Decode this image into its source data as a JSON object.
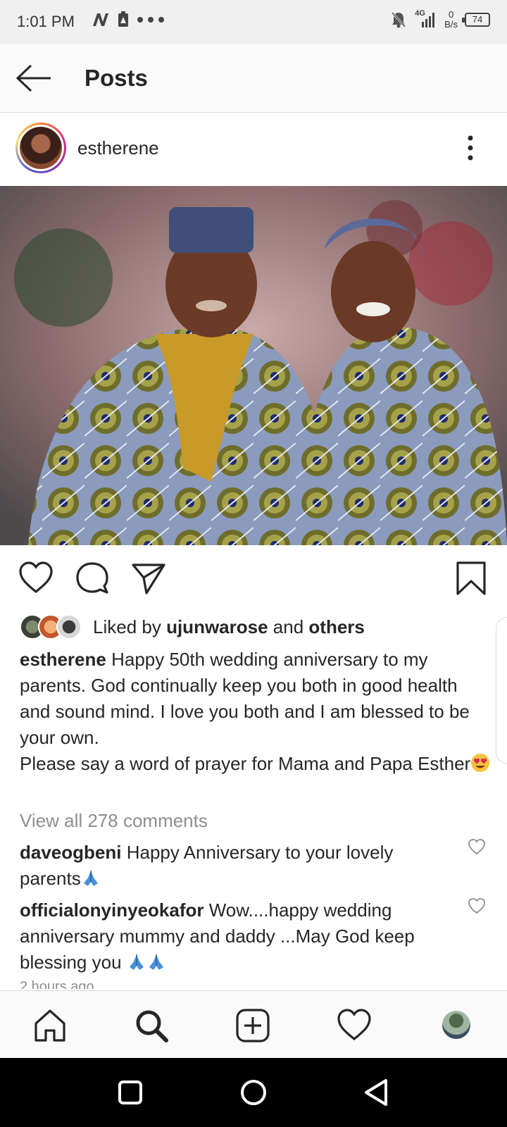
{
  "status_bar": {
    "time": "1:01 PM",
    "network_label": "4G",
    "net_speed_value": "0",
    "net_speed_unit": "B/s",
    "battery": "74",
    "icons": [
      "n-icon",
      "lock-notification-icon",
      "more-dots-icon",
      "mute-icon",
      "signal-icon"
    ]
  },
  "header": {
    "title": "Posts",
    "back_icon": "arrow-left-icon"
  },
  "post": {
    "username": "estherene",
    "more_icon": "vertical-dots-icon",
    "image_description_icon": "photo",
    "likes": {
      "prefix": "Liked by",
      "user": "ujunwarose",
      "middle": "and",
      "suffix": "others"
    },
    "caption": {
      "username": "estherene",
      "text_line1": "Happy 50th wedding anniversary to my parents. God continually keep you both in good health and sound mind. I love you both and I am blessed to be your own.",
      "text_line2": "Please say a word of prayer for Mama and Papa Esther"
    },
    "view_comments": "View all 278 comments",
    "comments": [
      {
        "username": "daveogbeni",
        "text": "Happy Anniversary to your lovely parents"
      },
      {
        "username": "officialonyinyeokafor",
        "text": "Wow....happy wedding anniversary mummy and daddy ...May God keep blessing you"
      }
    ],
    "timestamp": "2 hours ago"
  },
  "bottom_nav": [
    "home-icon",
    "search-icon",
    "add-post-icon",
    "activity-heart-icon",
    "profile-avatar"
  ],
  "android_nav": [
    "recents-square-icon",
    "home-circle-icon",
    "back-triangle-icon"
  ],
  "colors": {
    "text": "#262626",
    "muted": "#8e8e8e",
    "border": "#dbdbdb",
    "story_ring": "#dd2a7b"
  }
}
